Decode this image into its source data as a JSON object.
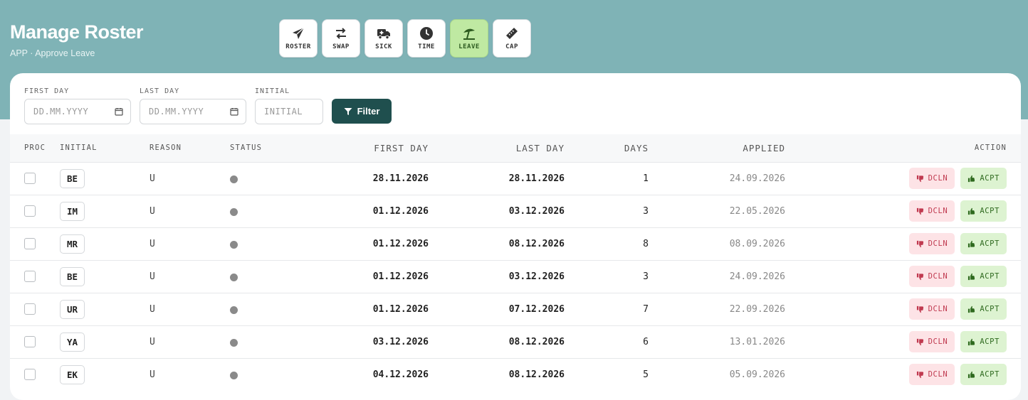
{
  "header": {
    "title": "Manage Roster",
    "subtitle": "APP · Approve Leave"
  },
  "nav": [
    {
      "label": "ROSTER",
      "icon": "paper-plane-icon",
      "active": false
    },
    {
      "label": "SWAP",
      "icon": "swap-arrows-icon",
      "active": false
    },
    {
      "label": "SICK",
      "icon": "ambulance-icon",
      "active": false
    },
    {
      "label": "TIME",
      "icon": "clock-icon",
      "active": false
    },
    {
      "label": "LEAVE",
      "icon": "umbrella-beach-icon",
      "active": true
    },
    {
      "label": "CAP",
      "icon": "ruler-icon",
      "active": false
    }
  ],
  "filters": {
    "first_day": {
      "label": "FIRST DAY",
      "placeholder": "DD.MM.YYYY"
    },
    "last_day": {
      "label": "LAST DAY",
      "placeholder": "DD.MM.YYYY"
    },
    "initial": {
      "label": "INITIAL",
      "placeholder": "INITIAL"
    },
    "button": "Filter"
  },
  "table": {
    "columns": {
      "proc": "PROC",
      "initial": "INITIAL",
      "reason": "REASON",
      "status": "STATUS",
      "first_day": "FIRST DAY",
      "last_day": "LAST DAY",
      "days": "DAYS",
      "applied": "APPLIED",
      "action": "ACTION"
    },
    "decline_label": "DCLN",
    "accept_label": "ACPT",
    "rows": [
      {
        "initial": "BE",
        "reason": "U",
        "first_day": "28.11.2026",
        "last_day": "28.11.2026",
        "days": "1",
        "applied": "24.09.2026"
      },
      {
        "initial": "IM",
        "reason": "U",
        "first_day": "01.12.2026",
        "last_day": "03.12.2026",
        "days": "3",
        "applied": "22.05.2026"
      },
      {
        "initial": "MR",
        "reason": "U",
        "first_day": "01.12.2026",
        "last_day": "08.12.2026",
        "days": "8",
        "applied": "08.09.2026"
      },
      {
        "initial": "BE",
        "reason": "U",
        "first_day": "01.12.2026",
        "last_day": "03.12.2026",
        "days": "3",
        "applied": "24.09.2026"
      },
      {
        "initial": "UR",
        "reason": "U",
        "first_day": "01.12.2026",
        "last_day": "07.12.2026",
        "days": "7",
        "applied": "22.09.2026"
      },
      {
        "initial": "YA",
        "reason": "U",
        "first_day": "03.12.2026",
        "last_day": "08.12.2026",
        "days": "6",
        "applied": "13.01.2026"
      },
      {
        "initial": "EK",
        "reason": "U",
        "first_day": "04.12.2026",
        "last_day": "08.12.2026",
        "days": "5",
        "applied": "05.09.2026"
      }
    ]
  },
  "colors": {
    "header_bg": "#7fb3b6",
    "filter_button": "#1f4f4e",
    "active_nav": "#bfe9a2",
    "decline_bg": "#fde3e6",
    "accept_bg": "#ddf3d1",
    "status_dot": "#8a8a8a"
  }
}
